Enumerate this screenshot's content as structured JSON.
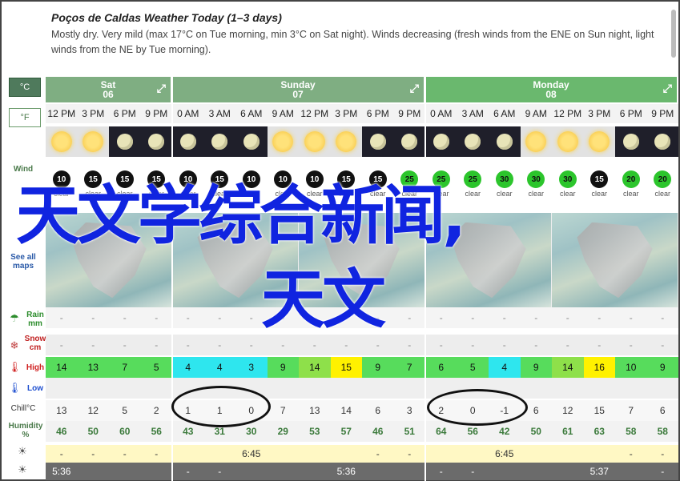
{
  "header": {
    "title": "Poços de Caldas Weather Today (1–3 days)",
    "description": "Mostly dry. Very mild (max 17°C on Tue morning, min 3°C on Sat night). Winds decreasing (fresh winds from the ENE on Sun night, light winds from the NE by Tue morning)."
  },
  "units": {
    "celsius": "°C",
    "fahrenheit": "°F"
  },
  "left_labels": {
    "wind": "Wind",
    "maps": "See all maps",
    "rain": "Rain mm",
    "snow": "Snow cm",
    "high": "High",
    "low": "Low",
    "chill": "Chill°C",
    "humidity": "Humidity %"
  },
  "days": [
    {
      "name": "Sat",
      "date": "06"
    },
    {
      "name": "Sunday",
      "date": "07"
    },
    {
      "name": "Monday",
      "date": "08"
    }
  ],
  "times": [
    "12 PM",
    "3 PM",
    "6 PM",
    "9 PM",
    "0 AM",
    "3 AM",
    "6 AM",
    "9 AM",
    "12 PM",
    "3 PM",
    "6 PM",
    "9 PM",
    "0 AM",
    "3 AM",
    "6 AM",
    "9 AM",
    "12 PM",
    "3 PM",
    "6 PM",
    "9 PM"
  ],
  "sky": [
    "day",
    "day",
    "night",
    "night",
    "night",
    "night",
    "night",
    "day",
    "day",
    "day",
    "night",
    "night",
    "night",
    "night",
    "night",
    "day",
    "day",
    "day",
    "night",
    "night"
  ],
  "wind_speeds": [
    "10",
    "15",
    "15",
    "15",
    "10",
    "15",
    "10",
    "10",
    "10",
    "15",
    "15",
    "25",
    "25",
    "25",
    "30",
    "30",
    "30",
    "15",
    "20",
    "20"
  ],
  "wind_text": [
    "clear",
    "clear",
    "clear",
    "clear",
    "clear",
    "clear",
    "clear",
    "clear",
    "clear",
    "clear",
    "clear",
    "clear",
    "clear",
    "clear",
    "clear",
    "clear",
    "clear",
    "clear",
    "clear",
    "clear"
  ],
  "rain": [
    "-",
    "-",
    "-",
    "-",
    "-",
    "-",
    "-",
    "-",
    "-",
    "-",
    "-",
    "-",
    "-",
    "-",
    "-",
    "-",
    "-",
    "-",
    "-",
    "-"
  ],
  "snow": [
    "-",
    "-",
    "-",
    "-",
    "-",
    "-",
    "-",
    "-",
    "-",
    "-",
    "-",
    "-",
    "-",
    "-",
    "-",
    "-",
    "-",
    "-",
    "-",
    "-"
  ],
  "high": [
    "14",
    "13",
    "7",
    "5",
    "4",
    "4",
    "3",
    "9",
    "14",
    "15",
    "9",
    "7",
    "6",
    "5",
    "4",
    "9",
    "14",
    "16",
    "10",
    "9"
  ],
  "high_colors": [
    "lgreen",
    "lgreen",
    "lgreen",
    "lgreen",
    "cyan",
    "cyan",
    "cyan",
    "lgreen",
    "lime",
    "yellow",
    "lgreen",
    "lgreen",
    "lgreen",
    "lgreen",
    "cyan",
    "lgreen",
    "lime",
    "yellow",
    "lgreen",
    "lgreen"
  ],
  "low": [
    "",
    "",
    "",
    "",
    "",
    "",
    "",
    "",
    "",
    "",
    "",
    "",
    "",
    "",
    "",
    "",
    "",
    "",
    "",
    ""
  ],
  "chill": [
    "13",
    "12",
    "5",
    "2",
    "1",
    "1",
    "0",
    "7",
    "13",
    "14",
    "6",
    "3",
    "2",
    "0",
    "-1",
    "6",
    "12",
    "15",
    "7",
    "6"
  ],
  "humidity": [
    "46",
    "50",
    "60",
    "56",
    "43",
    "31",
    "30",
    "29",
    "53",
    "57",
    "46",
    "51",
    "64",
    "56",
    "42",
    "50",
    "61",
    "63",
    "58",
    "58"
  ],
  "sunrise": [
    "-",
    "-",
    "-",
    "-",
    "",
    "",
    "6:45",
    "",
    "",
    "",
    "-",
    "-",
    "",
    "",
    "6:45",
    "",
    "",
    "",
    "-",
    "-"
  ],
  "sunset": [
    "5:36",
    "",
    "",
    "",
    "-",
    "-",
    "",
    "",
    "",
    "5:36",
    "",
    "",
    "-",
    "-",
    "",
    "",
    "",
    "5:37",
    "",
    "-"
  ],
  "overlay": {
    "line1": "天文学综合新闻,",
    "line2": "天文"
  },
  "colors": {
    "header_green": "#7fae82",
    "active_green": "#6ab86e",
    "overlay_blue": "#1024e0"
  }
}
